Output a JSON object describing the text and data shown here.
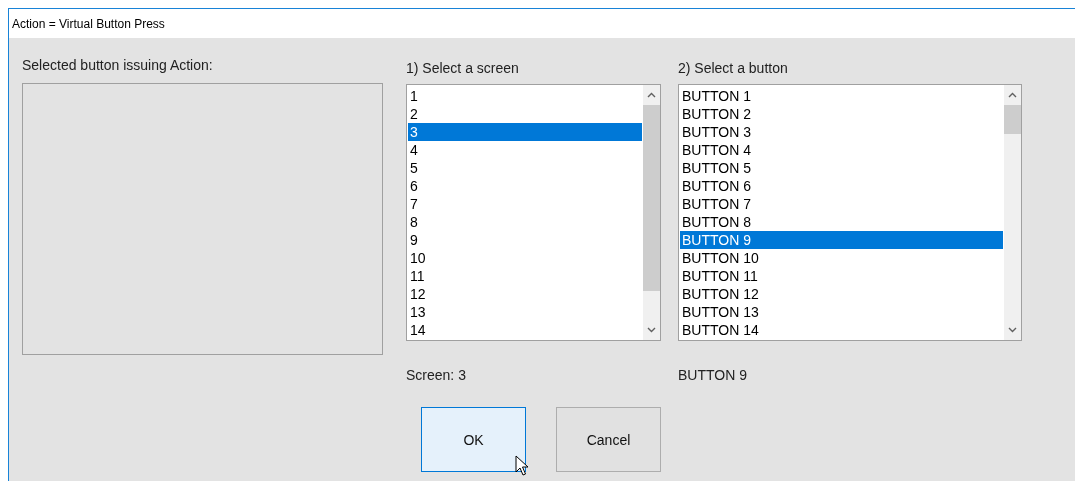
{
  "window": {
    "title": "Action = Virtual Button Press"
  },
  "selected_button_panel": {
    "label": "Selected button issuing Action:"
  },
  "screen_list": {
    "label": "1) Select a screen",
    "items": [
      {
        "text": "1",
        "selected": false
      },
      {
        "text": "2",
        "selected": false
      },
      {
        "text": "3",
        "selected": true
      },
      {
        "text": "4",
        "selected": false
      },
      {
        "text": "5",
        "selected": false
      },
      {
        "text": "6",
        "selected": false
      },
      {
        "text": "7",
        "selected": false
      },
      {
        "text": "8",
        "selected": false
      },
      {
        "text": "9",
        "selected": false
      },
      {
        "text": "10",
        "selected": false
      },
      {
        "text": "11",
        "selected": false
      },
      {
        "text": "12",
        "selected": false
      },
      {
        "text": "13",
        "selected": false
      },
      {
        "text": "14",
        "selected": false
      }
    ],
    "caption": "Screen: 3"
  },
  "button_list": {
    "label": "2) Select a button",
    "items": [
      {
        "text": "BUTTON 1",
        "selected": false
      },
      {
        "text": "BUTTON 2",
        "selected": false
      },
      {
        "text": "BUTTON 3",
        "selected": false
      },
      {
        "text": "BUTTON 4",
        "selected": false
      },
      {
        "text": "BUTTON 5",
        "selected": false
      },
      {
        "text": "BUTTON 6",
        "selected": false
      },
      {
        "text": "BUTTON 7",
        "selected": false
      },
      {
        "text": "BUTTON 8",
        "selected": false
      },
      {
        "text": "BUTTON 9",
        "selected": true
      },
      {
        "text": "BUTTON 10",
        "selected": false
      },
      {
        "text": "BUTTON 11",
        "selected": false
      },
      {
        "text": "BUTTON 12",
        "selected": false
      },
      {
        "text": "BUTTON 13",
        "selected": false
      },
      {
        "text": "BUTTON 14",
        "selected": false
      }
    ],
    "caption": "BUTTON 9"
  },
  "buttons": [
    {
      "label": "OK",
      "kind": "default"
    },
    {
      "label": "Cancel",
      "kind": "normal"
    }
  ]
}
